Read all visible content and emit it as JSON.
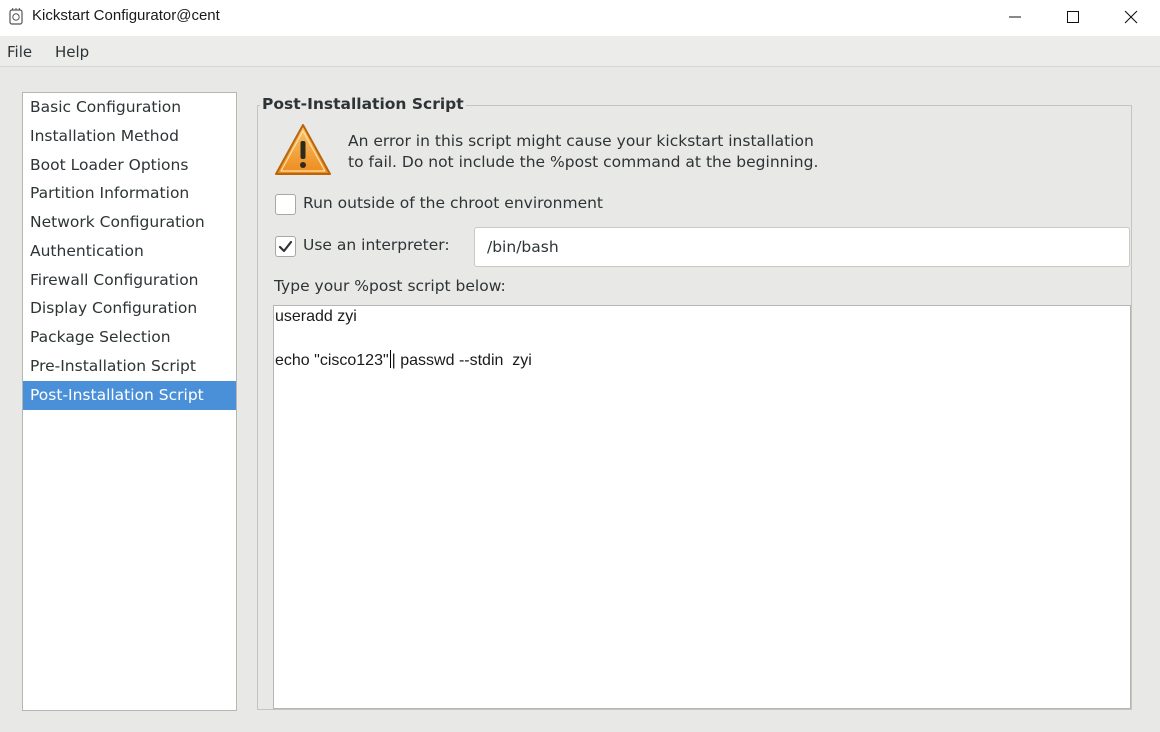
{
  "window": {
    "title": "Kickstart Configurator@cent",
    "icon": "kickstart-app-icon",
    "controls": [
      "minimize-icon",
      "maximize-icon",
      "close-icon"
    ]
  },
  "menu": {
    "file": "File",
    "help": "Help"
  },
  "sidebar": {
    "items": [
      {
        "label": "Basic Configuration"
      },
      {
        "label": "Installation Method"
      },
      {
        "label": "Boot Loader Options"
      },
      {
        "label": "Partition Information"
      },
      {
        "label": "Network Configuration"
      },
      {
        "label": "Authentication"
      },
      {
        "label": "Firewall Configuration"
      },
      {
        "label": "Display Configuration"
      },
      {
        "label": "Package Selection"
      },
      {
        "label": "Pre-Installation Script"
      },
      {
        "label": "Post-Installation Script"
      }
    ],
    "selected": "Post-Installation Script"
  },
  "main": {
    "frame_title": "Post-Installation Script",
    "warning_icon": "warning-icon",
    "warning_text": "An error in this script might cause your kickstart installation\nto fail. Do not include the %post command at the beginning.",
    "chroot_checkbox": {
      "label": "Run outside of the chroot environment",
      "checked": false
    },
    "interpreter_checkbox": {
      "label": "Use an interpreter:",
      "checked": true
    },
    "interpreter_value": "/bin/bash",
    "script_label": "Type your %post script below:",
    "script": {
      "line1": "useradd zyi",
      "line3_before_caret": "echo \"cisco123\"",
      "line3_after_caret": "| passwd --stdin  zyi"
    }
  },
  "colors": {
    "selection": "#4a90d9",
    "warning": "#f0a030"
  }
}
